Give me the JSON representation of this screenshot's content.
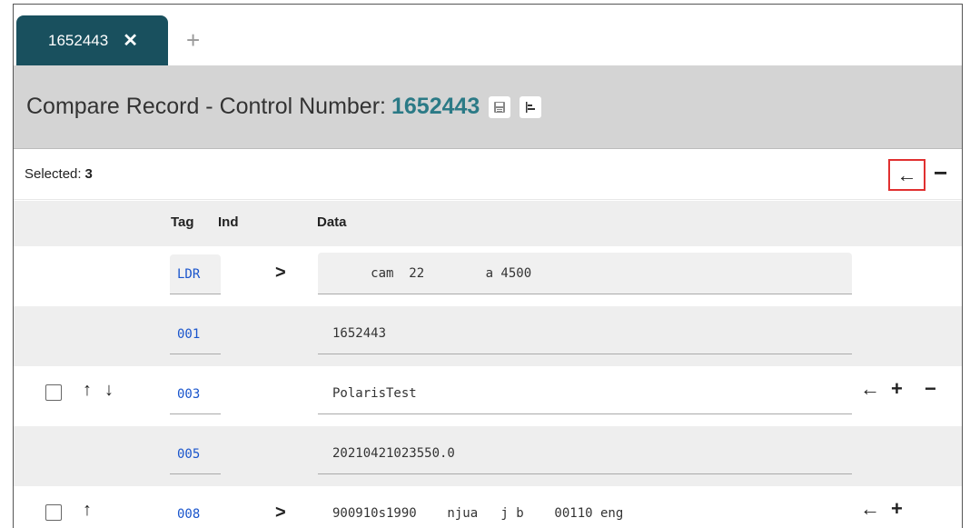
{
  "tabs": [
    {
      "label": "1652443",
      "close_glyph": "✕"
    }
  ],
  "add_tab_glyph": "+",
  "header": {
    "title_prefix": "Compare Record - Control Number:",
    "control_number": "1652443",
    "save_icon": "save-icon",
    "compare_icon": "align-left-icon"
  },
  "selection": {
    "label": "Selected:",
    "count": "3"
  },
  "columns": {
    "tag": "Tag",
    "ind": "Ind",
    "data": "Data"
  },
  "rows": [
    {
      "tag": "LDR",
      "ind": ">",
      "data": "     cam  22        a 4500",
      "checkbox": false,
      "actions": []
    },
    {
      "tag": "001",
      "ind": "",
      "data": "1652443",
      "checkbox": false,
      "actions": []
    },
    {
      "tag": "003",
      "ind": "",
      "data": "PolarisTest",
      "checkbox": true,
      "actions": [
        "←",
        "+",
        "−"
      ],
      "moves": [
        "↑",
        "↓"
      ]
    },
    {
      "tag": "005",
      "ind": "",
      "data": "20210421023550.0",
      "checkbox": false,
      "actions": []
    },
    {
      "tag": "008",
      "ind": ">",
      "data": "900910s1990    njua   j b    00110 eng  ",
      "checkbox": true,
      "actions": [
        "←",
        "+"
      ],
      "moves": [
        "↑"
      ]
    }
  ],
  "toolbar_glyphs": {
    "back": "←",
    "remove": "−"
  },
  "colors": {
    "tab_bg": "#19505e",
    "control_number": "#2b7a86",
    "tag_link": "#1a55cc",
    "highlight_border": "#e03030"
  }
}
